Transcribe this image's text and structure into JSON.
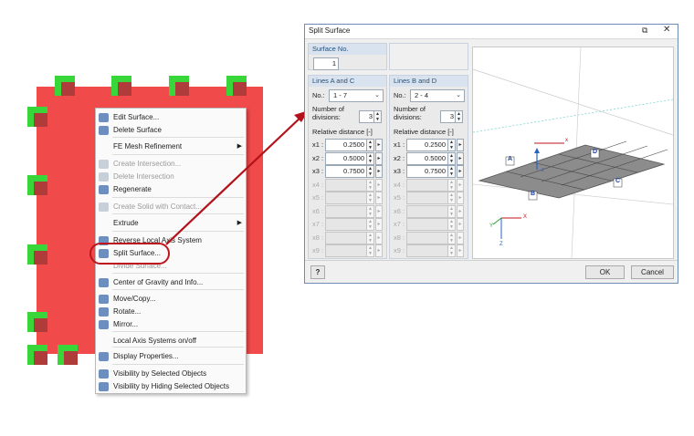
{
  "colors": {
    "surface": "#f04a4a",
    "node": "#39d639",
    "accent": "#c0141c"
  },
  "context_menu": {
    "items": [
      {
        "label": "Edit Surface...",
        "icon": "edit-surface-icon",
        "enabled": true
      },
      {
        "label": "Delete Surface",
        "icon": "delete-surface-icon",
        "enabled": true
      },
      {
        "label": "FE Mesh Refinement",
        "icon": "",
        "enabled": true,
        "submenu": true
      },
      {
        "label": "Create Intersection...",
        "icon": "intersection-icon",
        "enabled": false
      },
      {
        "label": "Delete Intersection",
        "icon": "delete-intersection-icon",
        "enabled": false
      },
      {
        "label": "Regenerate",
        "icon": "regenerate-icon",
        "enabled": true
      },
      {
        "label": "Create Solid with Contact...",
        "icon": "solid-icon",
        "enabled": false
      },
      {
        "label": "Extrude",
        "icon": "",
        "enabled": true,
        "submenu": true
      },
      {
        "label": "Reverse Local Axis System",
        "icon": "reverse-axis-icon",
        "enabled": true
      },
      {
        "label": "Split Surface...",
        "icon": "split-surface-icon",
        "enabled": true
      },
      {
        "label": "Divide Surface...",
        "icon": "",
        "enabled": false
      },
      {
        "label": "Center of Gravity and Info...",
        "icon": "center-gravity-icon",
        "enabled": true
      },
      {
        "label": "Move/Copy...",
        "icon": "move-copy-icon",
        "enabled": true
      },
      {
        "label": "Rotate...",
        "icon": "rotate-icon",
        "enabled": true
      },
      {
        "label": "Mirror...",
        "icon": "mirror-icon",
        "enabled": true
      },
      {
        "label": "Local Axis Systems on/off",
        "icon": "",
        "enabled": true
      },
      {
        "label": "Display Properties...",
        "icon": "display-properties-icon",
        "enabled": true
      },
      {
        "label": "Visibility by Selected Objects",
        "icon": "visibility-selected-icon",
        "enabled": true
      },
      {
        "label": "Visibility by Hiding Selected Objects",
        "icon": "visibility-hiding-icon",
        "enabled": true
      }
    ]
  },
  "dialog": {
    "title": "Split Surface",
    "surface_no": {
      "label": "Surface No.",
      "value": "1"
    },
    "group_ac": {
      "title": "Lines A and C",
      "no_label": "No.:",
      "no_value": "1 - 7",
      "divisions_label_1": "Number of",
      "divisions_label_2": "divisions:",
      "divisions": "3",
      "relative_label": "Relative distance [-]",
      "rows": [
        {
          "label": "x1 :",
          "value": "0.2500",
          "enabled": true
        },
        {
          "label": "x2 :",
          "value": "0.5000",
          "enabled": true
        },
        {
          "label": "x3 :",
          "value": "0.7500",
          "enabled": true
        },
        {
          "label": "x4 :",
          "value": "",
          "enabled": false
        },
        {
          "label": "x5 :",
          "value": "",
          "enabled": false
        },
        {
          "label": "x6 :",
          "value": "",
          "enabled": false
        },
        {
          "label": "x7 :",
          "value": "",
          "enabled": false
        },
        {
          "label": "x8 :",
          "value": "",
          "enabled": false
        },
        {
          "label": "x9 :",
          "value": "",
          "enabled": false
        }
      ]
    },
    "group_bd": {
      "title": "Lines B and D",
      "no_label": "No.:",
      "no_value": "2 - 4",
      "divisions_label_1": "Number of",
      "divisions_label_2": "divisions:",
      "divisions": "3",
      "relative_label": "Relative distance [-]",
      "rows": [
        {
          "label": "x1 :",
          "value": "0.2500",
          "enabled": true
        },
        {
          "label": "x2 :",
          "value": "0.5000",
          "enabled": true
        },
        {
          "label": "x3 :",
          "value": "0.7500",
          "enabled": true
        },
        {
          "label": "x4 :",
          "value": "",
          "enabled": false
        },
        {
          "label": "x5 :",
          "value": "",
          "enabled": false
        },
        {
          "label": "x6 :",
          "value": "",
          "enabled": false
        },
        {
          "label": "x7 :",
          "value": "",
          "enabled": false
        },
        {
          "label": "x8 :",
          "value": "",
          "enabled": false
        },
        {
          "label": "x9 :",
          "value": "",
          "enabled": false
        }
      ]
    },
    "preview": {
      "edge_a": "A",
      "edge_b": "B",
      "edge_c": "C",
      "edge_d": "D",
      "axis_x": "X",
      "axis_y": "Y",
      "axis_z": "Z",
      "plate_x": "x",
      "plate_y": "y",
      "plate_z": "z"
    },
    "ok_label": "OK",
    "cancel_label": "Cancel"
  }
}
